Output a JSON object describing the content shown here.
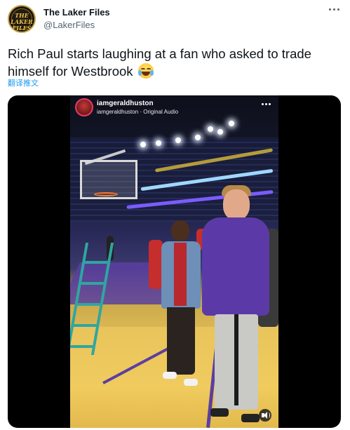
{
  "tweet": {
    "avatar_text": "THE LAKER FILES",
    "display_name": "The Laker Files",
    "handle": "@LakerFiles",
    "text": "Rich Paul starts laughing at a fan who asked to trade himself for Westbrook",
    "emoji": "face-with-tears-of-joy-icon",
    "translate_label": "翻译推文"
  },
  "video": {
    "username": "iamgeraldhuston",
    "subtitle": "iamgeraldhuston · Original Audio"
  },
  "colors": {
    "link": "#1d9bf0",
    "secondary_text": "#536471",
    "primary_text": "#0f1419"
  }
}
